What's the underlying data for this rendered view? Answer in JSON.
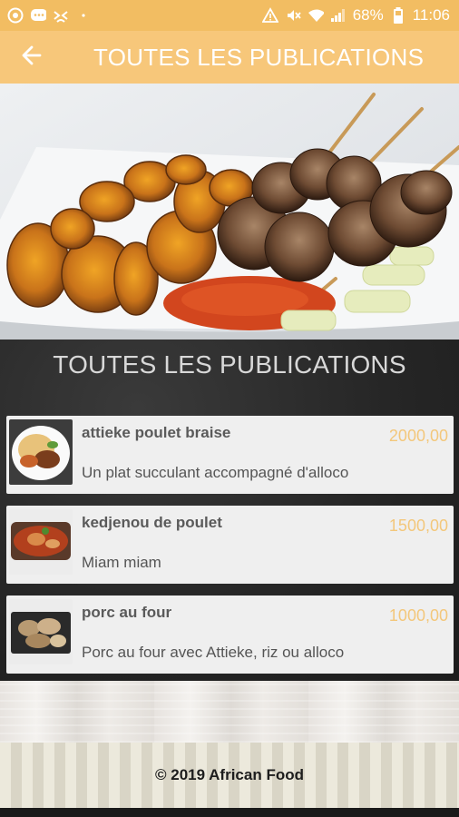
{
  "status_bar": {
    "battery": "68%",
    "time": "11:06",
    "icons": [
      "record-icon",
      "chat-icon",
      "mask-icon",
      "dot-icon",
      "warning-icon",
      "mute-icon",
      "wifi-icon",
      "signal-icon",
      "battery-icon"
    ]
  },
  "app_bar": {
    "title": "TOUTES LES PUBLICATIONS",
    "back_icon": "arrow-left-icon"
  },
  "section": {
    "title": "TOUTES LES PUBLICATIONS"
  },
  "posts": [
    {
      "title": "attieke poulet braise",
      "price": "2000,00",
      "description": "Un plat succulant accompagné d'alloco"
    },
    {
      "title": "kedjenou de poulet",
      "price": "1500,00",
      "description": "Miam miam"
    },
    {
      "title": "porc au four",
      "price": "1000,00",
      "description": "Porc au four avec Attieke, riz ou alloco"
    }
  ],
  "footer": {
    "text": "© 2019 African Food"
  },
  "colors": {
    "status_bar": "#f2bd62",
    "app_bar": "#f7c77a",
    "price": "#f3c77b",
    "card": "#efefef",
    "board": "#262626"
  }
}
